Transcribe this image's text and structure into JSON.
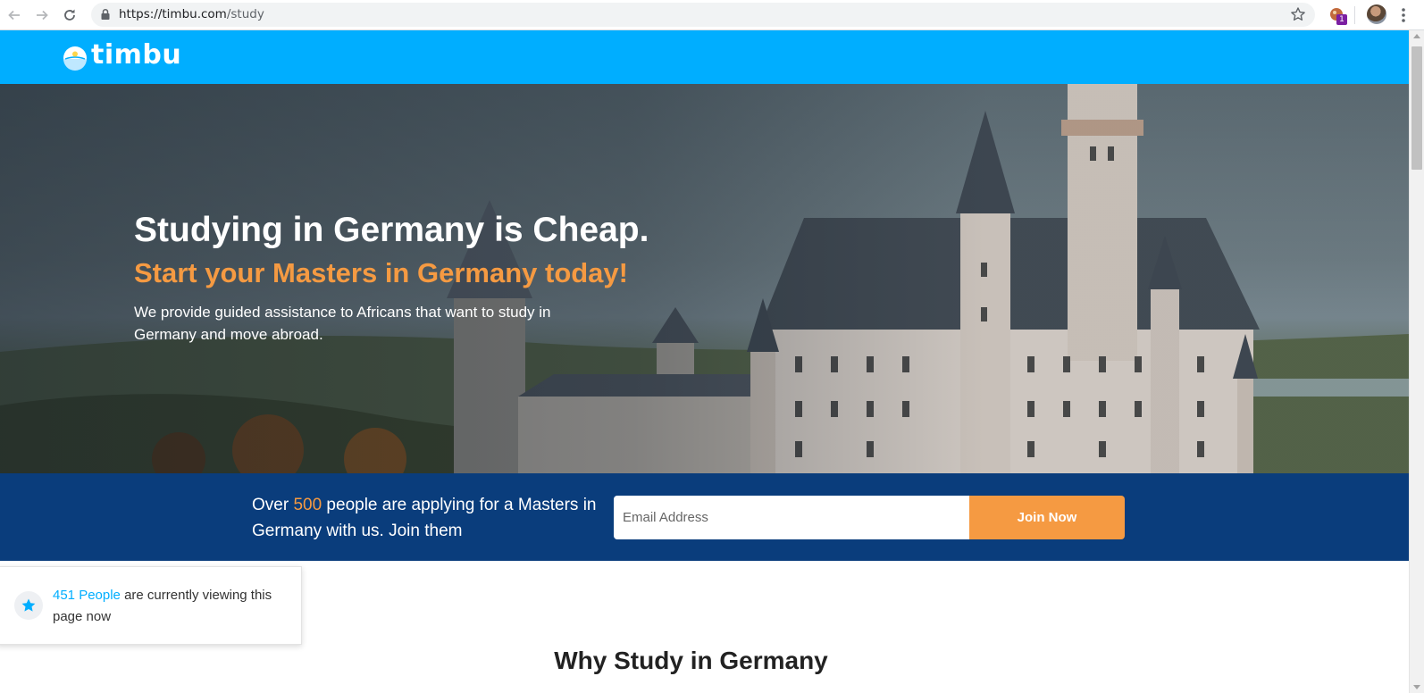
{
  "browser": {
    "url_host": "https://timbu.com",
    "url_path": "/study",
    "extension_badge": "1",
    "icons": [
      "back-arrow-icon",
      "forward-arrow-icon",
      "reload-icon",
      "lock-icon",
      "bookmark-star-icon",
      "extension-icon",
      "profile-avatar",
      "menu-dots-icon"
    ]
  },
  "header": {
    "logo_text": "timbu",
    "background": "#00aeff"
  },
  "hero": {
    "title": "Studying in Germany is Cheap.",
    "subtitle": "Start your Masters in Germany today!",
    "description": "We provide guided assistance to Africans that want to study in Germany and move abroad.",
    "subtitle_color": "#f59a42"
  },
  "signup": {
    "text_before": "Over ",
    "count": "500",
    "text_after": " people are applying for a Masters in Germany with us. Join them",
    "email_placeholder": "Email Address",
    "button_label": "Join Now",
    "background": "#0a3d7c",
    "accent": "#f59a42"
  },
  "viewers": {
    "count_text": "451 People",
    "rest_text": " are currently viewing this page now",
    "icon": "star-icon"
  },
  "section": {
    "heading": "Why Study in Germany"
  }
}
